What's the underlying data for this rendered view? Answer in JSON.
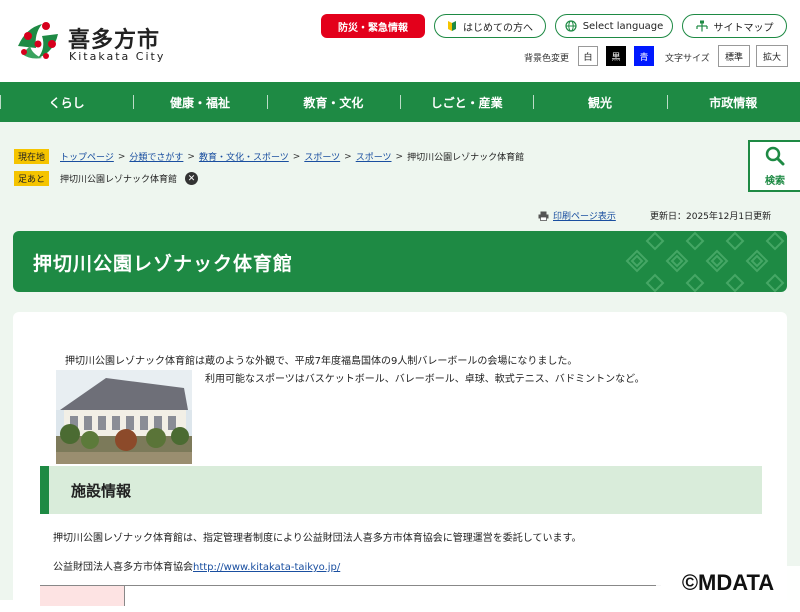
{
  "header": {
    "logo_ja": "喜多方市",
    "logo_en": "Kitakata City",
    "emergency_label": "防災・緊急情報",
    "first_time_label": "はじめての方へ",
    "language_label": "Select language",
    "sitemap_label": "サイトマップ",
    "bg_color_label": "背景色変更",
    "bg_white": "白",
    "bg_black": "黒",
    "bg_blue": "青",
    "font_size_label": "文字サイズ",
    "font_standard": "標準",
    "font_large": "拡大"
  },
  "nav": {
    "items": [
      "くらし",
      "健康・福祉",
      "教育・文化",
      "しごと・産業",
      "観光",
      "市政情報"
    ]
  },
  "breadcrumb": {
    "current_tag": "現在地",
    "links": [
      "トップページ",
      "分類でさがす",
      "教育・文化・スポーツ",
      "スポーツ",
      "スポーツ"
    ],
    "current": "押切川公園レゾナック体育館",
    "history_tag": "足あと",
    "history_item": "押切川公園レゾナック体育館"
  },
  "search": {
    "label": "検索"
  },
  "utility": {
    "print_label": "印刷ページ表示",
    "updated": "更新日：2025年12月1日更新"
  },
  "page": {
    "title": "押切川公園レゾナック体育館",
    "intro": "押切川公園レゾナック体育館は蔵のような外観で、平成7年度福島国体の9人制バレーボールの会場になりました。",
    "sports": "利用可能なスポーツはバスケットボール、バレーボール、卓球、軟式テニス、バドミントンなど。",
    "section_title": "施設情報",
    "para1": "押切川公園レゾナック体育館は、指定管理者制度により公益財団法人喜多方市体育協会に管理運営を委託しています。",
    "para2_prefix": "公益財団法人喜多方市体育協会",
    "para2_link": "http://www.kitakata-taikyo.jp/"
  },
  "watermark": "©MDATA",
  "colors": {
    "brand_green": "#1e8a44",
    "emergency_red": "#e3001b",
    "crumb_yellow": "#f5c400",
    "link_blue": "#1a4fa0",
    "page_bg": "#eef6ef"
  }
}
